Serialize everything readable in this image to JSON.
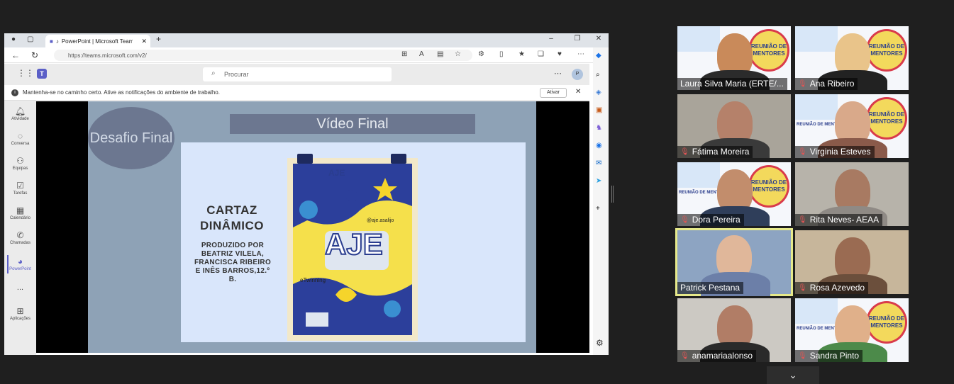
{
  "browser": {
    "tab_title": "PowerPoint | Microsoft Teams",
    "url": "https://teams.microsoft.com/v2/"
  },
  "teams": {
    "search_placeholder": "Procurar",
    "avatar_initial": "P",
    "notification": "Mantenha-se no caminho certo. Ative as notificações do ambiente de trabalho.",
    "activate_label": "Ativar",
    "rail": [
      {
        "label": "Atividade",
        "icon": "bell-icon"
      },
      {
        "label": "Conversa",
        "icon": "chat-icon"
      },
      {
        "label": "Equipas",
        "icon": "teams-icon"
      },
      {
        "label": "Tarefas",
        "icon": "tasks-icon"
      },
      {
        "label": "Calendário",
        "icon": "calendar-icon"
      },
      {
        "label": "Chamadas",
        "icon": "phone-icon"
      },
      {
        "label": "PowerPoint",
        "icon": "powerpoint-icon"
      },
      {
        "label": "...",
        "icon": "more-icon"
      },
      {
        "label": "Aplicações",
        "icon": "apps-icon"
      }
    ]
  },
  "slide": {
    "badge": "Desafio Final",
    "banner": "Vídeo Final",
    "cartaz_line1": "CARTAZ",
    "cartaz_line2": "DINÂMICO",
    "produzido": "PRODUZIDO POR BEATRIZ VILELA, FRANCISCA RIBEIRO E INÊS BARROS,12.º B.",
    "poster_logo_top": "AJE",
    "poster_logo_big": "AJE",
    "poster_handle": "@aje.asalijo",
    "poster_etwinning": "eTwinning"
  },
  "participants": [
    {
      "name": "Laura Silva Maria (ERTE/...",
      "muted": false
    },
    {
      "name": "Ana Ribeiro",
      "muted": true
    },
    {
      "name": "Fátima Moreira",
      "muted": true
    },
    {
      "name": "Virginia Esteves",
      "muted": true
    },
    {
      "name": "Dora Pereira",
      "muted": true
    },
    {
      "name": "Rita Neves- AEAA",
      "muted": true
    },
    {
      "name": "Patrick Pestana",
      "muted": false
    },
    {
      "name": "Rosa Azevedo",
      "muted": true
    },
    {
      "name": "anamariaalonso",
      "muted": true
    },
    {
      "name": "Sandra Pinto",
      "muted": true
    }
  ],
  "banner_text": {
    "reuniao_badge": "REUNIÃO DE MENTORES",
    "reuniao_header": "REUNIÃO DE MENTORES"
  }
}
